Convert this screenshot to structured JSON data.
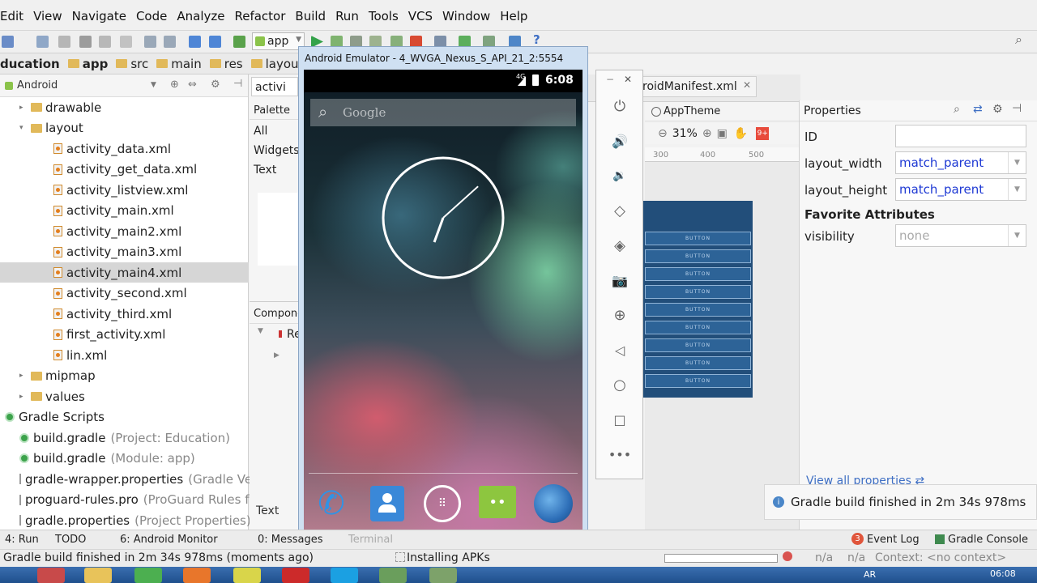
{
  "menu": [
    "Edit",
    "View",
    "Navigate",
    "Code",
    "Analyze",
    "Refactor",
    "Build",
    "Run",
    "Tools",
    "VCS",
    "Window",
    "Help"
  ],
  "toolbar": {
    "config": "app"
  },
  "breadcrumb": [
    "ducation",
    "app",
    "src",
    "main",
    "res",
    "layout"
  ],
  "project": {
    "view": "Android",
    "tree": [
      {
        "label": "drawable",
        "type": "folder",
        "indent": 1,
        "tri": "▸"
      },
      {
        "label": "layout",
        "type": "folder",
        "indent": 1,
        "tri": "▾"
      },
      {
        "label": "activity_data.xml",
        "type": "xml",
        "indent": 2
      },
      {
        "label": "activity_get_data.xml",
        "type": "xml",
        "indent": 2
      },
      {
        "label": "activity_listview.xml",
        "type": "xml",
        "indent": 2
      },
      {
        "label": "activity_main.xml",
        "type": "xml",
        "indent": 2
      },
      {
        "label": "activity_main2.xml",
        "type": "xml",
        "indent": 2
      },
      {
        "label": "activity_main3.xml",
        "type": "xml",
        "indent": 2
      },
      {
        "label": "activity_main4.xml",
        "type": "xml",
        "indent": 2,
        "selected": true
      },
      {
        "label": "activity_second.xml",
        "type": "xml",
        "indent": 2
      },
      {
        "label": "activity_third.xml",
        "type": "xml",
        "indent": 2
      },
      {
        "label": "first_activity.xml",
        "type": "xml",
        "indent": 2
      },
      {
        "label": "lin.xml",
        "type": "xml",
        "indent": 2
      },
      {
        "label": "mipmap",
        "type": "folder",
        "indent": 1,
        "tri": "▸"
      },
      {
        "label": "values",
        "type": "folder",
        "indent": 1,
        "tri": "▸"
      },
      {
        "label": "Gradle Scripts",
        "type": "gradle",
        "indent": 0
      },
      {
        "label": "build.gradle",
        "extra": "(Project: Education)",
        "type": "gradle",
        "indent": 1
      },
      {
        "label": "build.gradle",
        "extra": "(Module: app)",
        "type": "gradle",
        "indent": 1
      },
      {
        "label": "gradle-wrapper.properties",
        "extra": "(Gradle Vers",
        "type": "file",
        "indent": 1
      },
      {
        "label": "proguard-rules.pro",
        "extra": "(ProGuard Rules fo",
        "type": "file",
        "indent": 1
      },
      {
        "label": "gradle.properties",
        "extra": "(Project Properties)",
        "type": "file",
        "indent": 1
      }
    ]
  },
  "editor": {
    "tab_left": "activi",
    "tab_manifest": "roidManifest.xml",
    "palette_label": "Palette",
    "palette_items": [
      "All",
      "Widgets",
      "Text"
    ],
    "component_label": "Compone",
    "component_item": "Re",
    "bottom_tab": "Text",
    "theme": "AppTheme",
    "zoom": "31%",
    "ruler": [
      "300",
      "400",
      "500"
    ],
    "blueprint_button_label": "BUTTON",
    "blueprint_button_count": 9
  },
  "properties": {
    "title": "Properties",
    "id_label": "ID",
    "id_value": "",
    "layout_width_label": "layout_width",
    "layout_width_value": "match_parent",
    "layout_height_label": "layout_height",
    "layout_height_value": "match_parent",
    "favorites_title": "Favorite Attributes",
    "visibility_label": "visibility",
    "visibility_value": "none",
    "view_all": "View all properties ⇄"
  },
  "emulator": {
    "title": "Android Emulator - 4_WVGA_Nexus_S_API_21_2:5554",
    "time": "6:08",
    "network": "4G",
    "search_hint": "Google",
    "clock_hour_deg": 200,
    "clock_min_deg": 48,
    "dock_colors": {
      "phone": "#2f93e6",
      "contacts": "#3a88d8",
      "apps": "#ffffff",
      "messaging": "#8dc63f",
      "browser": "#2e6fb8"
    }
  },
  "side_controls": [
    "minimize",
    "close",
    "power-icon",
    "volume-up-icon",
    "volume-down-icon",
    "rotate-left-icon",
    "rotate-right-icon",
    "camera-icon",
    "zoom-icon",
    "back-icon",
    "home-icon",
    "overview-icon",
    "more-icon"
  ],
  "toast": {
    "message": "Gradle build finished in 2m 34s 978ms"
  },
  "bottom_tabs": {
    "run": "4: Run",
    "todo": "TODO",
    "monitor": "6: Android Monitor",
    "messages": "0: Messages",
    "terminal": "Terminal",
    "event_log": "Event Log",
    "event_count": "3",
    "gradle_console": "Gradle Console"
  },
  "status": {
    "message": "Gradle build finished in 2m 34s 978ms (moments ago)",
    "task": "Installing APKs",
    "na1": "n/a",
    "na2": "n/a",
    "context": "Context: <no context>"
  },
  "taskbar": {
    "clock": "06:08",
    "lang": "AR"
  }
}
